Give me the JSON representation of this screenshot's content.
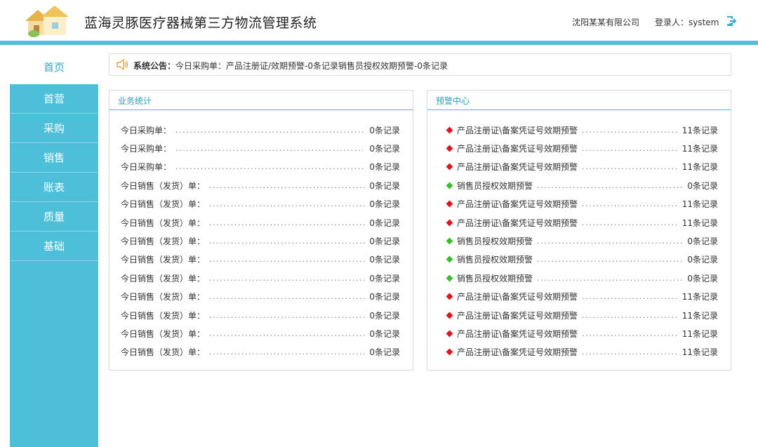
{
  "header": {
    "title": "蓝海灵豚医疗器械第三方物流管理系统",
    "company": "沈阳某某有限公司",
    "login": "登录人：system"
  },
  "sidebar": {
    "items": [
      {
        "label": "首页",
        "active": true
      },
      {
        "label": "首营"
      },
      {
        "label": "采购"
      },
      {
        "label": "销售"
      },
      {
        "label": "账表"
      },
      {
        "label": "质量"
      },
      {
        "label": "基础"
      }
    ]
  },
  "notice": {
    "label": "系统公告：",
    "text": "今日采购单：产品注册证/效期预警-0条记录销售员授权效期预警-0条记录"
  },
  "stats": {
    "title": "业务统计",
    "rows": [
      {
        "label": "今日采购单：",
        "count": "0条记录"
      },
      {
        "label": "今日采购单：",
        "count": "0条记录"
      },
      {
        "label": "今日采购单：",
        "count": "0条记录"
      },
      {
        "label": "今日销售（发货）单：",
        "count": "0条记录"
      },
      {
        "label": "今日销售（发货）单：",
        "count": "0条记录"
      },
      {
        "label": "今日销售（发货）单：",
        "count": "0条记录"
      },
      {
        "label": "今日销售（发货）单：",
        "count": "0条记录"
      },
      {
        "label": "今日销售（发货）单：",
        "count": "0条记录"
      },
      {
        "label": "今日销售（发货）单：",
        "count": "0条记录"
      },
      {
        "label": "今日销售（发货）单：",
        "count": "0条记录"
      },
      {
        "label": "今日销售（发货）单：",
        "count": "0条记录"
      },
      {
        "label": "今日销售（发货）单：",
        "count": "0条记录"
      },
      {
        "label": "今日销售（发货）单：",
        "count": "0条记录"
      }
    ]
  },
  "alerts": {
    "title": "预警中心",
    "rows": [
      {
        "label": "产品注册证\\备案凭证号效期预警",
        "count": "11条记录",
        "color": "#e0141e"
      },
      {
        "label": "产品注册证\\备案凭证号效期预警",
        "count": "11条记录",
        "color": "#e0141e"
      },
      {
        "label": "产品注册证\\备案凭证号效期预警",
        "count": "11条记录",
        "color": "#e0141e"
      },
      {
        "label": "销售员授权效期预警",
        "count": "0条记录",
        "color": "#36c12b"
      },
      {
        "label": "产品注册证\\备案凭证号效期预警",
        "count": "11条记录",
        "color": "#e0141e"
      },
      {
        "label": "产品注册证\\备案凭证号效期预警",
        "count": "11条记录",
        "color": "#e0141e"
      },
      {
        "label": "销售员授权效期预警",
        "count": "0条记录",
        "color": "#36c12b"
      },
      {
        "label": "销售员授权效期预警",
        "count": "0条记录",
        "color": "#36c12b"
      },
      {
        "label": "销售员授权效期预警",
        "count": "0条记录",
        "color": "#36c12b"
      },
      {
        "label": "产品注册证\\备案凭证号效期预警",
        "count": "11条记录",
        "color": "#e0141e"
      },
      {
        "label": "产品注册证\\备案凭证号效期预警",
        "count": "11条记录",
        "color": "#e0141e"
      },
      {
        "label": "产品注册证\\备案凭证号效期预警",
        "count": "11条记录",
        "color": "#e0141e"
      },
      {
        "label": "产品注册证\\备案凭证号效期预警",
        "count": "11条记录",
        "color": "#e0141e"
      }
    ]
  },
  "colors": {
    "accent": "#4ebfd9",
    "alert_red": "#e0141e",
    "ok_green": "#36c12b"
  },
  "icons": {
    "logo": "houses-logo-icon",
    "logout": "logout-icon",
    "notice": "speaker-icon"
  }
}
